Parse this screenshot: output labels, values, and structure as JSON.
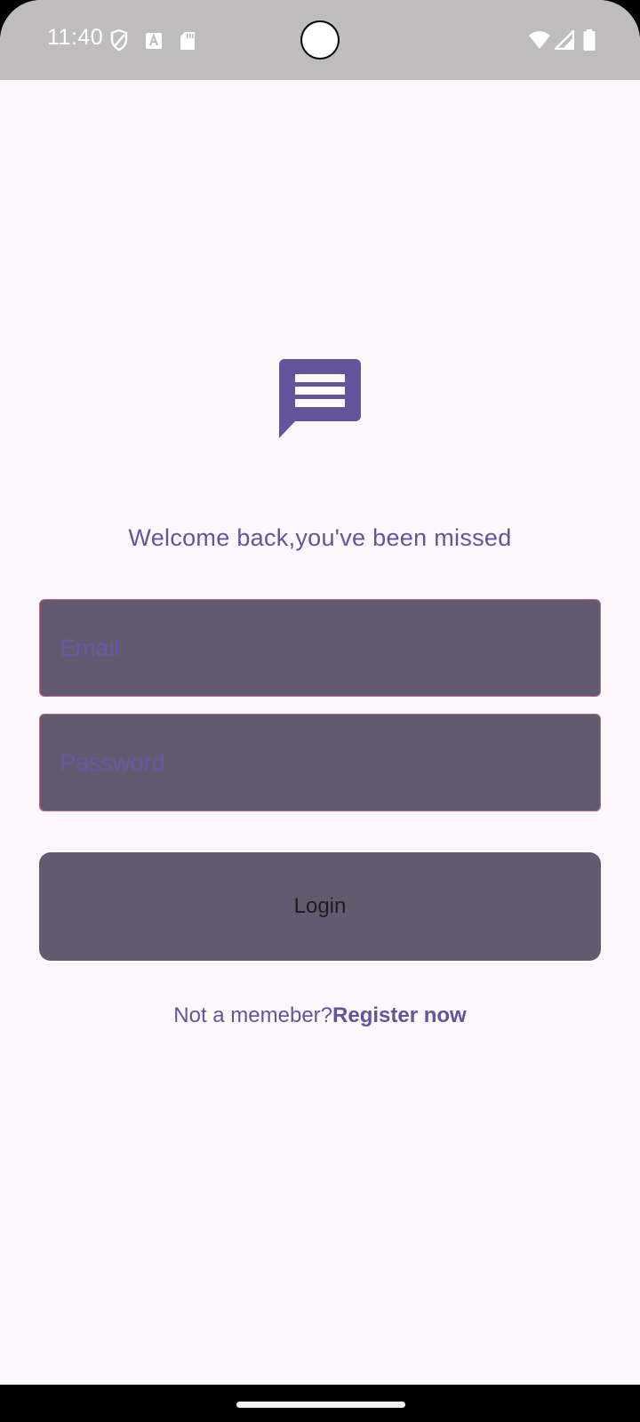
{
  "status_bar": {
    "time": "11:40",
    "left_icons": [
      "shield-icon",
      "font-download-icon",
      "sd-card-icon"
    ],
    "right_icons": [
      "wifi-icon",
      "signal-icon",
      "battery-icon"
    ]
  },
  "logo": {
    "icon": "message-icon",
    "color": "#67539c"
  },
  "welcome_text": "Welcome back,you've been missed",
  "form": {
    "email_placeholder": "Email",
    "email_value": "",
    "password_placeholder": "Password",
    "password_value": "",
    "login_label": "Login"
  },
  "register": {
    "prompt": "Not a memeber?",
    "link_label": "Register now"
  },
  "colors": {
    "background": "#fef7fc",
    "primary": "#67539c",
    "field_fill": "#645a70",
    "field_border": "#c46c8a",
    "status_bar": "#bebcbd"
  }
}
